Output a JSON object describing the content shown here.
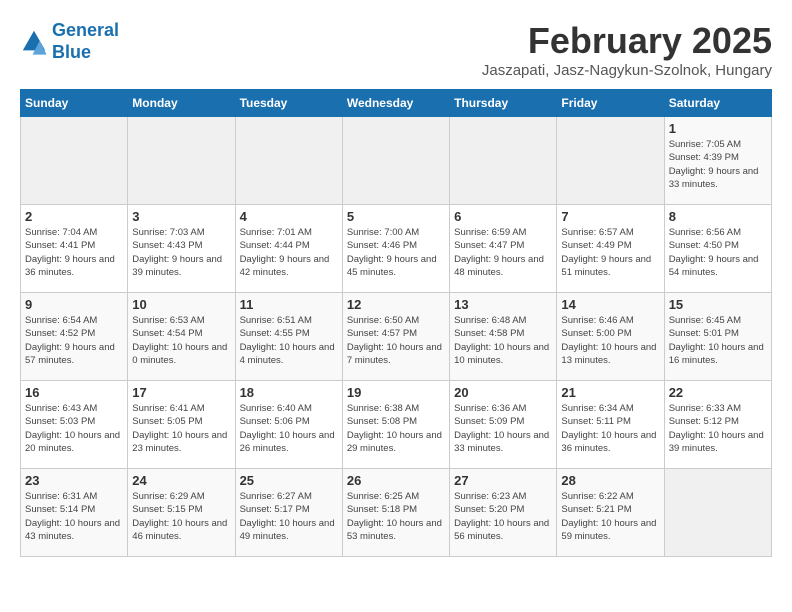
{
  "header": {
    "logo_line1": "General",
    "logo_line2": "Blue",
    "title": "February 2025",
    "subtitle": "Jaszapati, Jasz-Nagykun-Szolnok, Hungary"
  },
  "weekdays": [
    "Sunday",
    "Monday",
    "Tuesday",
    "Wednesday",
    "Thursday",
    "Friday",
    "Saturday"
  ],
  "weeks": [
    [
      {
        "day": "",
        "info": ""
      },
      {
        "day": "",
        "info": ""
      },
      {
        "day": "",
        "info": ""
      },
      {
        "day": "",
        "info": ""
      },
      {
        "day": "",
        "info": ""
      },
      {
        "day": "",
        "info": ""
      },
      {
        "day": "1",
        "info": "Sunrise: 7:05 AM\nSunset: 4:39 PM\nDaylight: 9 hours and 33 minutes."
      }
    ],
    [
      {
        "day": "2",
        "info": "Sunrise: 7:04 AM\nSunset: 4:41 PM\nDaylight: 9 hours and 36 minutes."
      },
      {
        "day": "3",
        "info": "Sunrise: 7:03 AM\nSunset: 4:43 PM\nDaylight: 9 hours and 39 minutes."
      },
      {
        "day": "4",
        "info": "Sunrise: 7:01 AM\nSunset: 4:44 PM\nDaylight: 9 hours and 42 minutes."
      },
      {
        "day": "5",
        "info": "Sunrise: 7:00 AM\nSunset: 4:46 PM\nDaylight: 9 hours and 45 minutes."
      },
      {
        "day": "6",
        "info": "Sunrise: 6:59 AM\nSunset: 4:47 PM\nDaylight: 9 hours and 48 minutes."
      },
      {
        "day": "7",
        "info": "Sunrise: 6:57 AM\nSunset: 4:49 PM\nDaylight: 9 hours and 51 minutes."
      },
      {
        "day": "8",
        "info": "Sunrise: 6:56 AM\nSunset: 4:50 PM\nDaylight: 9 hours and 54 minutes."
      }
    ],
    [
      {
        "day": "9",
        "info": "Sunrise: 6:54 AM\nSunset: 4:52 PM\nDaylight: 9 hours and 57 minutes."
      },
      {
        "day": "10",
        "info": "Sunrise: 6:53 AM\nSunset: 4:54 PM\nDaylight: 10 hours and 0 minutes."
      },
      {
        "day": "11",
        "info": "Sunrise: 6:51 AM\nSunset: 4:55 PM\nDaylight: 10 hours and 4 minutes."
      },
      {
        "day": "12",
        "info": "Sunrise: 6:50 AM\nSunset: 4:57 PM\nDaylight: 10 hours and 7 minutes."
      },
      {
        "day": "13",
        "info": "Sunrise: 6:48 AM\nSunset: 4:58 PM\nDaylight: 10 hours and 10 minutes."
      },
      {
        "day": "14",
        "info": "Sunrise: 6:46 AM\nSunset: 5:00 PM\nDaylight: 10 hours and 13 minutes."
      },
      {
        "day": "15",
        "info": "Sunrise: 6:45 AM\nSunset: 5:01 PM\nDaylight: 10 hours and 16 minutes."
      }
    ],
    [
      {
        "day": "16",
        "info": "Sunrise: 6:43 AM\nSunset: 5:03 PM\nDaylight: 10 hours and 20 minutes."
      },
      {
        "day": "17",
        "info": "Sunrise: 6:41 AM\nSunset: 5:05 PM\nDaylight: 10 hours and 23 minutes."
      },
      {
        "day": "18",
        "info": "Sunrise: 6:40 AM\nSunset: 5:06 PM\nDaylight: 10 hours and 26 minutes."
      },
      {
        "day": "19",
        "info": "Sunrise: 6:38 AM\nSunset: 5:08 PM\nDaylight: 10 hours and 29 minutes."
      },
      {
        "day": "20",
        "info": "Sunrise: 6:36 AM\nSunset: 5:09 PM\nDaylight: 10 hours and 33 minutes."
      },
      {
        "day": "21",
        "info": "Sunrise: 6:34 AM\nSunset: 5:11 PM\nDaylight: 10 hours and 36 minutes."
      },
      {
        "day": "22",
        "info": "Sunrise: 6:33 AM\nSunset: 5:12 PM\nDaylight: 10 hours and 39 minutes."
      }
    ],
    [
      {
        "day": "23",
        "info": "Sunrise: 6:31 AM\nSunset: 5:14 PM\nDaylight: 10 hours and 43 minutes."
      },
      {
        "day": "24",
        "info": "Sunrise: 6:29 AM\nSunset: 5:15 PM\nDaylight: 10 hours and 46 minutes."
      },
      {
        "day": "25",
        "info": "Sunrise: 6:27 AM\nSunset: 5:17 PM\nDaylight: 10 hours and 49 minutes."
      },
      {
        "day": "26",
        "info": "Sunrise: 6:25 AM\nSunset: 5:18 PM\nDaylight: 10 hours and 53 minutes."
      },
      {
        "day": "27",
        "info": "Sunrise: 6:23 AM\nSunset: 5:20 PM\nDaylight: 10 hours and 56 minutes."
      },
      {
        "day": "28",
        "info": "Sunrise: 6:22 AM\nSunset: 5:21 PM\nDaylight: 10 hours and 59 minutes."
      },
      {
        "day": "",
        "info": ""
      }
    ]
  ]
}
